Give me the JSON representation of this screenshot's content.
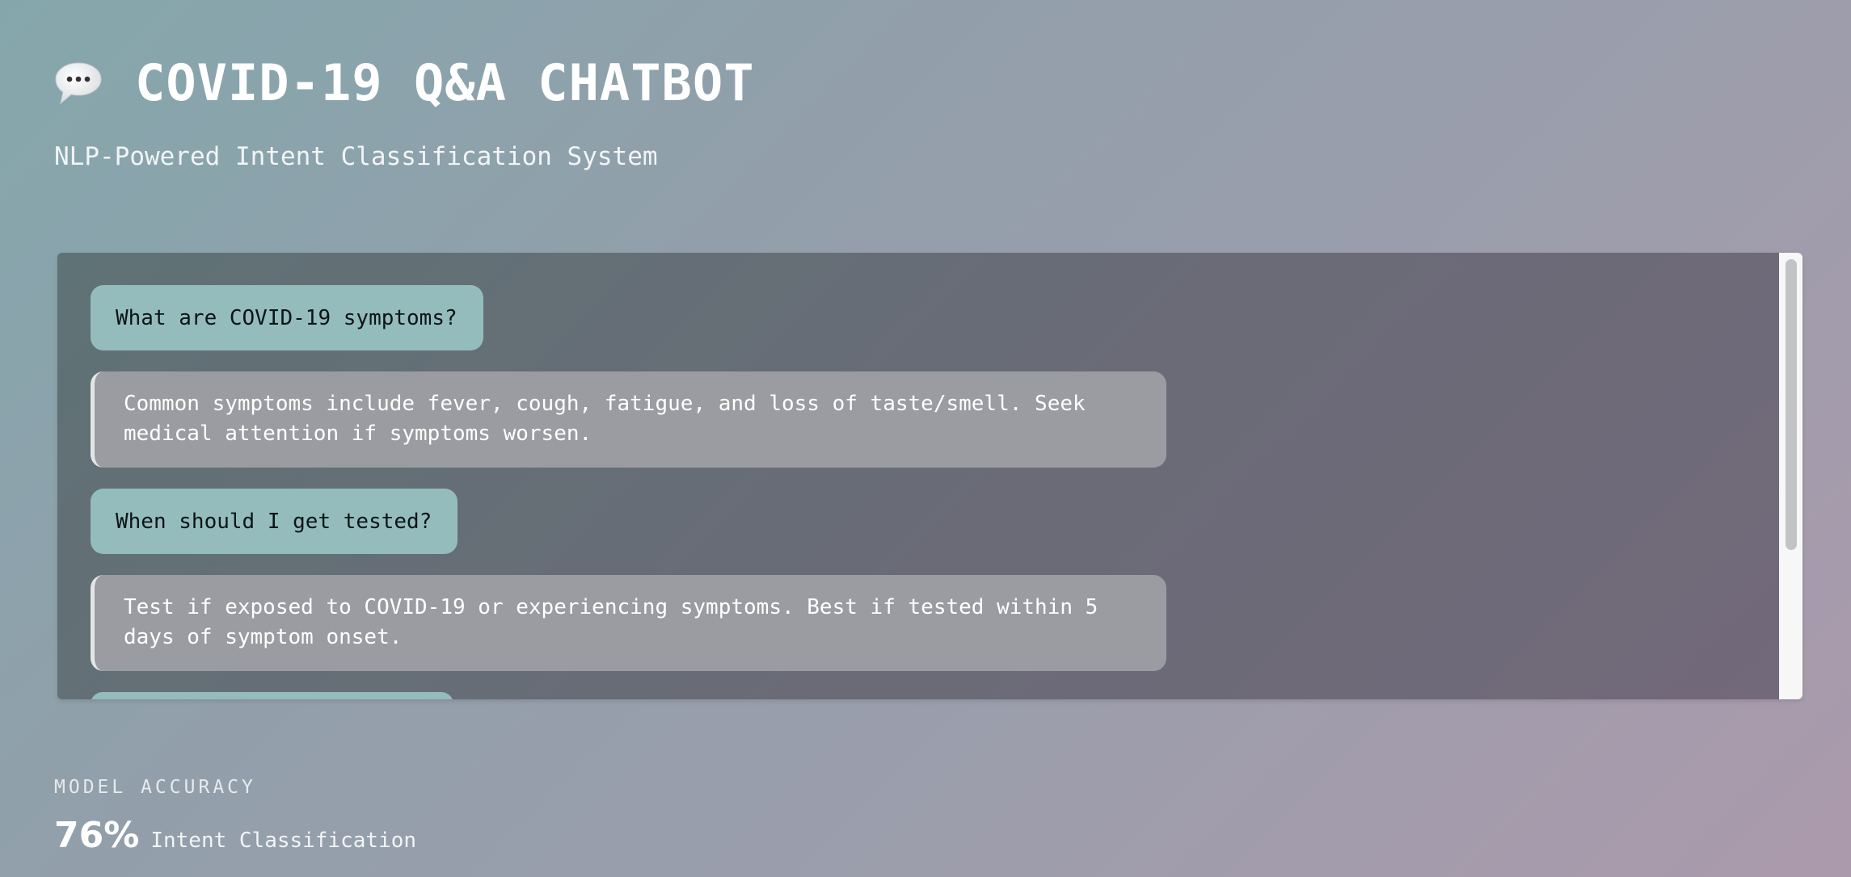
{
  "header": {
    "title": "COVID-19 Q&A CHATBOT",
    "subtitle": "NLP-Powered Intent Classification System",
    "icon": "speech-bubble-icon"
  },
  "chat": {
    "messages": [
      {
        "role": "user",
        "text": "What are COVID-19 symptoms?"
      },
      {
        "role": "bot",
        "text": "Common symptoms include fever, cough, fatigue, and loss of taste/smell. Seek medical attention if symptoms worsen."
      },
      {
        "role": "user",
        "text": "When should I get tested?"
      },
      {
        "role": "bot",
        "text": "Test if exposed to COVID-19 or experiencing symptoms. Best if tested within 5 days of symptom onset."
      }
    ]
  },
  "stats": {
    "label": "MODEL ACCURACY",
    "value": "76%",
    "caption": "Intent Classification"
  },
  "colors": {
    "user_bubble": "#94bcbd",
    "bot_bubble": "#9a9ca1",
    "panel": "#646c76"
  }
}
